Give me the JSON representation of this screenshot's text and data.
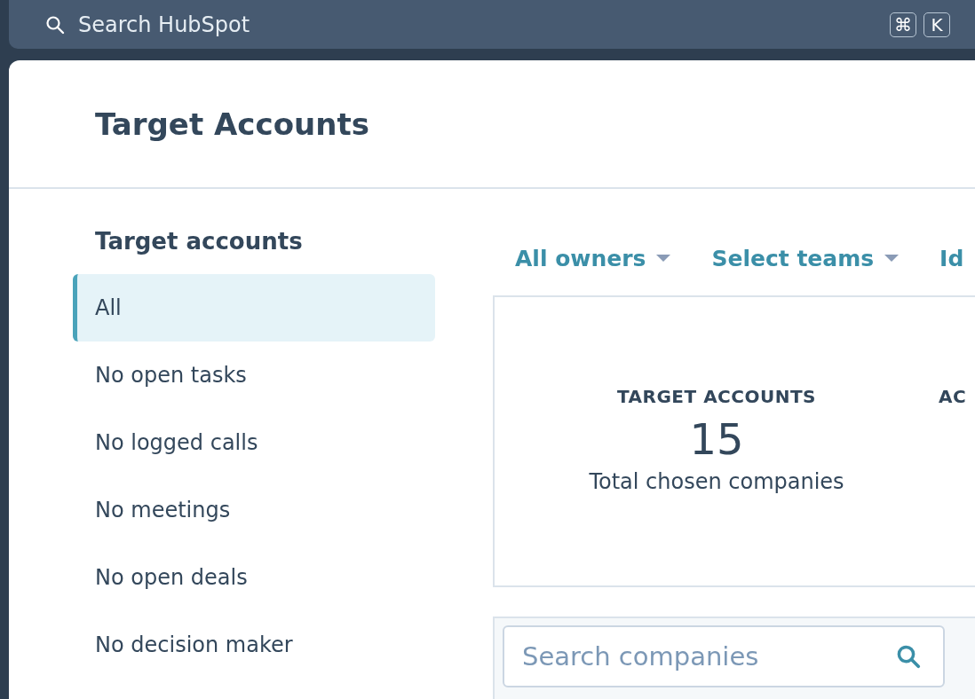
{
  "top_bar": {
    "search_placeholder": "Search HubSpot",
    "shortcut_keys": [
      "⌘",
      "K"
    ]
  },
  "page": {
    "title": "Target Accounts"
  },
  "sidebar": {
    "heading": "Target accounts",
    "items": [
      {
        "label": "All",
        "selected": true
      },
      {
        "label": "No open tasks",
        "selected": false
      },
      {
        "label": "No logged calls",
        "selected": false
      },
      {
        "label": "No meetings",
        "selected": false
      },
      {
        "label": "No open deals",
        "selected": false
      },
      {
        "label": "No decision maker",
        "selected": false
      }
    ]
  },
  "filters": [
    {
      "label": "All owners",
      "dropdown": true
    },
    {
      "label": "Select teams",
      "dropdown": true
    },
    {
      "label": "Id",
      "dropdown": false
    }
  ],
  "stats": [
    {
      "label": "TARGET ACCOUNTS",
      "value": "15",
      "caption": "Total chosen companies"
    },
    {
      "label": "AC"
    }
  ],
  "table": {
    "search": {
      "placeholder": "Search companies"
    }
  }
}
